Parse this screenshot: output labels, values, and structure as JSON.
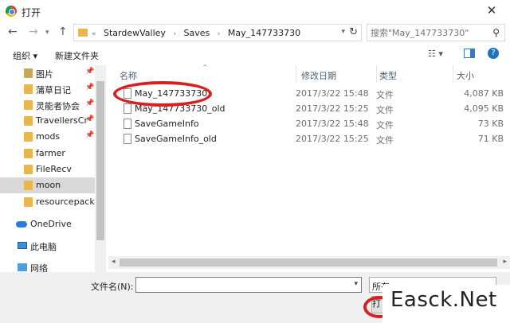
{
  "window": {
    "title": "打开",
    "close_glyph": "✕"
  },
  "address": {
    "crumbs": [
      "StardewValley",
      "Saves",
      "May_147733730"
    ],
    "prefix": "«",
    "separator": "›"
  },
  "search": {
    "placeholder": "搜索\"May_147733730\""
  },
  "toolbar": {
    "organize": "组织 ▾",
    "new_folder": "新建文件夹"
  },
  "sidebar": {
    "items": [
      {
        "label": "图片",
        "pinned": true
      },
      {
        "label": "蒲草日记",
        "pinned": true
      },
      {
        "label": "灵能者协会",
        "pinned": true
      },
      {
        "label": "TravellersCr",
        "pinned": true
      },
      {
        "label": "mods",
        "pinned": true
      },
      {
        "label": "farmer",
        "pinned": false
      },
      {
        "label": "FileRecv",
        "pinned": false
      },
      {
        "label": "moon",
        "pinned": false,
        "selected": true
      },
      {
        "label": "resourcepacks",
        "pinned": false
      },
      {
        "label": "OneDrive"
      },
      {
        "label": "此电脑"
      },
      {
        "label": "网络"
      }
    ]
  },
  "columns": {
    "name": "名称",
    "date": "修改日期",
    "type": "类型",
    "size": "大小"
  },
  "files": [
    {
      "name": "May_147733730",
      "date": "2017/3/22 15:48",
      "type": "文件",
      "size": "4,087 KB"
    },
    {
      "name": "May_147733730_old",
      "date": "2017/3/22 15:25",
      "type": "文件",
      "size": "4,095 KB"
    },
    {
      "name": "SaveGameInfo",
      "date": "2017/3/22 15:48",
      "type": "文件",
      "size": "73 KB"
    },
    {
      "name": "SaveGameInfo_old",
      "date": "2017/3/22 15:25",
      "type": "文件",
      "size": "71 KB"
    }
  ],
  "bottom": {
    "filename_label": "文件名(N):",
    "filename_value": "",
    "filetype_value": "所有",
    "open_label": "打"
  },
  "watermark": "Easck.Net",
  "colors": {
    "highlight_red": "#d82020",
    "folder": "#e8b64a",
    "selected_bg": "#d9d9d9"
  }
}
